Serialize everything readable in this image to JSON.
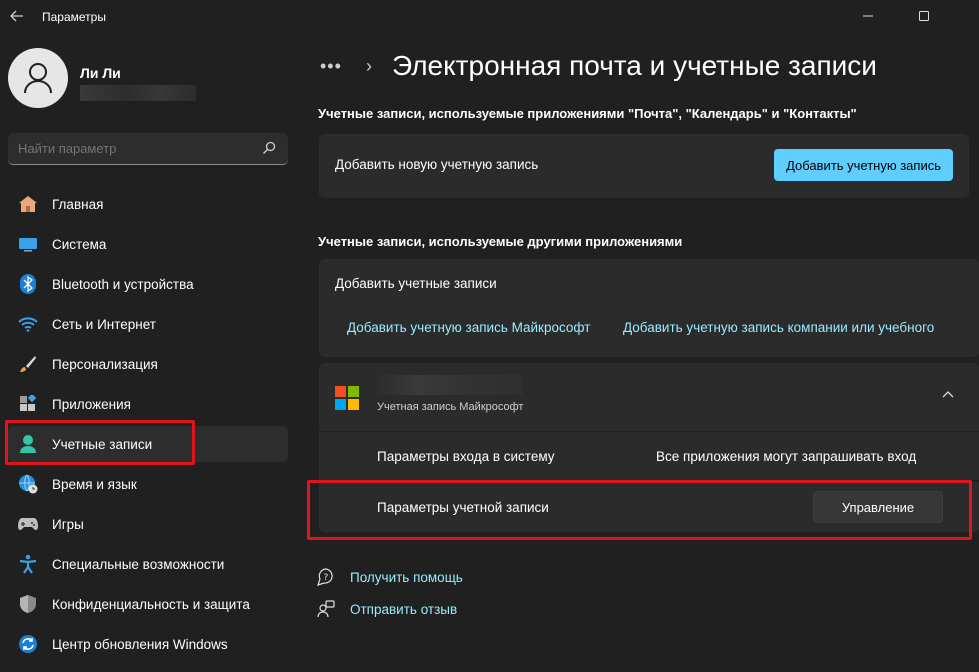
{
  "window": {
    "title": "Параметры"
  },
  "user": {
    "name": "Ли Ли"
  },
  "search": {
    "placeholder": "Найти параметр"
  },
  "sidebar": {
    "items": [
      {
        "label": "Главная",
        "icon": "home-icon"
      },
      {
        "label": "Система",
        "icon": "monitor-icon"
      },
      {
        "label": "Bluetooth и устройства",
        "icon": "bluetooth-icon"
      },
      {
        "label": "Сеть и Интернет",
        "icon": "wifi-icon"
      },
      {
        "label": "Персонализация",
        "icon": "brush-icon"
      },
      {
        "label": "Приложения",
        "icon": "apps-icon"
      },
      {
        "label": "Учетные записи",
        "icon": "accounts-icon",
        "active": true
      },
      {
        "label": "Время и язык",
        "icon": "globe-clock-icon"
      },
      {
        "label": "Игры",
        "icon": "gamepad-icon"
      },
      {
        "label": "Специальные возможности",
        "icon": "accessibility-icon"
      },
      {
        "label": "Конфиденциальность и защита",
        "icon": "shield-icon"
      },
      {
        "label": "Центр обновления Windows",
        "icon": "update-icon"
      }
    ]
  },
  "main": {
    "breadcrumb_dots": "•••",
    "breadcrumb_chevron": "›",
    "title": "Электронная почта и учетные записи",
    "section1": {
      "heading": "Учетные записи, используемые приложениями \"Почта\", \"Календарь\" и \"Контакты\"",
      "add_label": "Добавить новую учетную запись",
      "add_button": "Добавить учетную запись"
    },
    "section2": {
      "heading": "Учетные записи, используемые другими приложениями",
      "add_label": "Добавить учетные записи",
      "link_ms": "Добавить учетную запись Майкрософт",
      "link_work": "Добавить учетную запись компании или учебного"
    },
    "account": {
      "type": "Учетная запись Майкрософт",
      "signin_label": "Параметры входа в систему",
      "signin_value": "Все приложения могут запрашивать вход",
      "settings_label": "Параметры учетной записи",
      "manage_button": "Управление"
    },
    "help": {
      "get_help": "Получить помощь",
      "feedback": "Отправить отзыв"
    }
  },
  "colors": {
    "accent": "#60cdff",
    "link": "#99ebff",
    "highlight": "#e0141e",
    "ms_red": "#f25022",
    "ms_green": "#7fba00",
    "ms_blue": "#00a4ef",
    "ms_yellow": "#ffb900"
  }
}
